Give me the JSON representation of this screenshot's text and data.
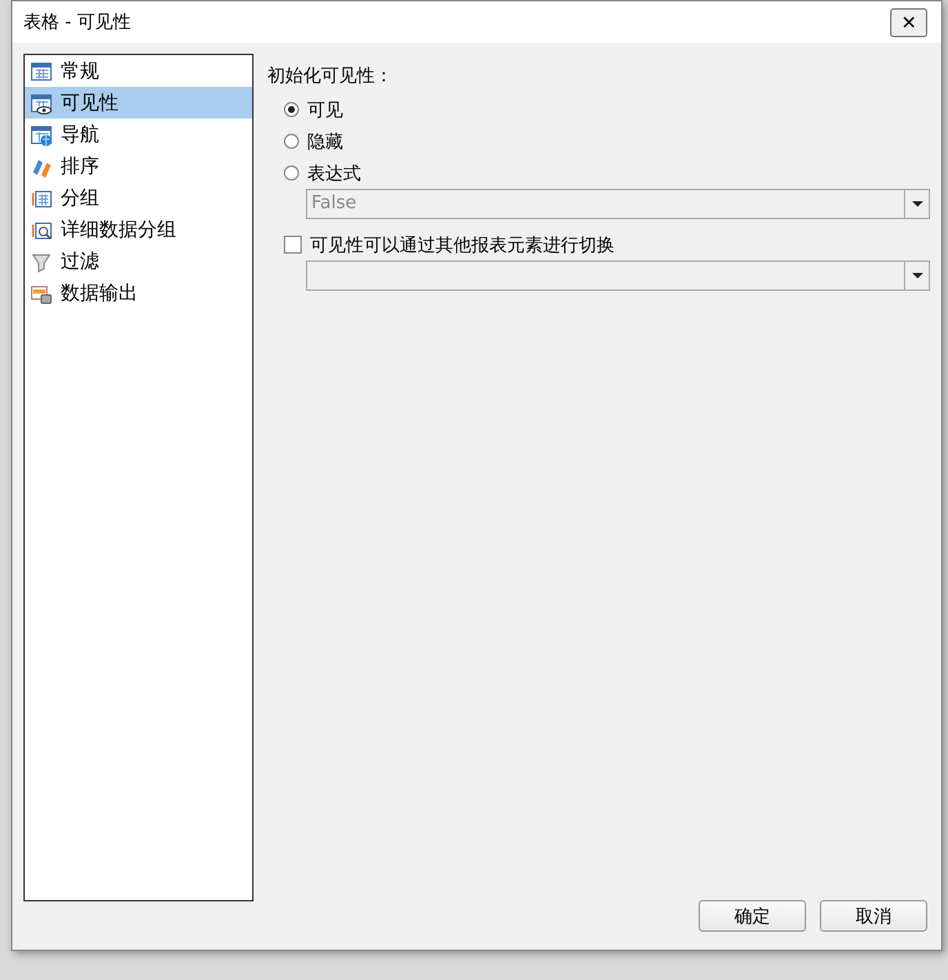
{
  "window": {
    "title": "表格 -  可见性",
    "close": "✕"
  },
  "sidebar": {
    "items": [
      {
        "label": "常规",
        "selected": false
      },
      {
        "label": "可见性",
        "selected": true
      },
      {
        "label": "导航",
        "selected": false
      },
      {
        "label": "排序",
        "selected": false
      },
      {
        "label": "分组",
        "selected": false
      },
      {
        "label": "详细数据分组",
        "selected": false
      },
      {
        "label": "过滤",
        "selected": false
      },
      {
        "label": "数据输出",
        "selected": false
      }
    ]
  },
  "visibility": {
    "heading": "初始化可见性：",
    "options": [
      {
        "label": "可见",
        "selected": true
      },
      {
        "label": "隐藏",
        "selected": false
      },
      {
        "label": "表达式",
        "selected": false
      }
    ],
    "expression": {
      "value": "False",
      "disabled": true
    },
    "toggle": {
      "label": "可见性可以通过其他报表元素进行切换",
      "checked": false
    },
    "toggle_item": {
      "disabled": true
    }
  },
  "buttons": [
    "确定",
    "取消"
  ]
}
